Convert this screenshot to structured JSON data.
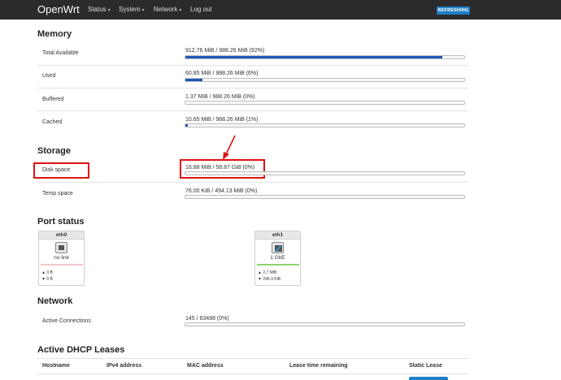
{
  "navbar": {
    "brand": "OpenWrt",
    "menu": [
      {
        "label": "Status",
        "caret": "▾"
      },
      {
        "label": "System",
        "caret": "▾"
      },
      {
        "label": "Network",
        "caret": "▾"
      },
      {
        "label": "Log out",
        "caret": ""
      }
    ],
    "badge": "REFRESHING"
  },
  "memory": {
    "title": "Memory",
    "rows": [
      {
        "label": "Total Available",
        "value": "912.76 MiB / 988.26 MiB (92%)",
        "percent": 92
      },
      {
        "label": "Used",
        "value": "60.85 MiB / 988.26 MiB (6%)",
        "percent": 6
      },
      {
        "label": "Buffered",
        "value": "1.37 MiB / 988.26 MiB (0%)",
        "percent": 0
      },
      {
        "label": "Cached",
        "value": "10.65 MiB / 988.26 MiB (1%)",
        "percent": 1
      }
    ]
  },
  "storage": {
    "title": "Storage",
    "rows": [
      {
        "label": "Disk space",
        "value": "16.88 MiB / 58.87 GiB (0%)",
        "percent": 0
      },
      {
        "label": "Temp space",
        "value": "76.00 KiB / 494.13 MiB (0%)",
        "percent": 0
      }
    ]
  },
  "ports": {
    "title": "Port status",
    "items": [
      {
        "name": "eth0",
        "status": "no link",
        "tx": "▲ 0 B",
        "rx": "▼ 0 B",
        "line_color": "#f0c8c8"
      },
      {
        "name": "eth1",
        "status": "1 GbE",
        "tx": "▲ 2.7 MiB",
        "rx": "▼ 246.9 KiB",
        "line_color": "#8bd36c"
      }
    ]
  },
  "network": {
    "title": "Network",
    "rows": [
      {
        "label": "Active Connections",
        "value": "145 / 63488 (0%)",
        "percent": 0
      }
    ]
  },
  "dhcp": {
    "title": "Active DHCP Leases",
    "headers": [
      "Hostname",
      "IPv4 address",
      "MAC address",
      "Lease time remaining",
      "Static Lease"
    ]
  },
  "colors": {
    "bar_fill": "#1f58b8",
    "annotation": "#e01010",
    "badge": "#1e7fc6"
  }
}
